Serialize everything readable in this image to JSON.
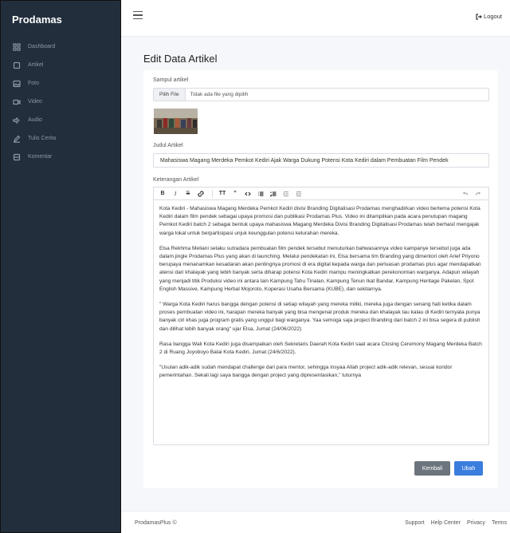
{
  "sidebar": {
    "brand": "Prodamas",
    "items": [
      {
        "label": "Dashboard",
        "icon": "grid-icon"
      },
      {
        "label": "Artikel",
        "icon": "square-icon"
      },
      {
        "label": "Foto",
        "icon": "image-icon"
      },
      {
        "label": "Video",
        "icon": "video-icon"
      },
      {
        "label": "Audio",
        "icon": "speaker-icon"
      },
      {
        "label": "Tulis Cerita",
        "icon": "pen-icon"
      },
      {
        "label": "Komentar",
        "icon": "table-icon"
      }
    ]
  },
  "topbar": {
    "logout_label": "Logout"
  },
  "page": {
    "title": "Edit Data Artikel"
  },
  "form": {
    "cover_label": "Sampul artikel",
    "file_button": "Pilih File",
    "file_status": "Tidak ada file yang dipilih",
    "title_label": "Judul Artikel",
    "title_value": "Mahasiswa Magang Merdeka Pemkot Kediri Ajak Warga Dukung Potensi Kota Kediri dalam Pembuatan Film Pendek",
    "desc_label": "Keterangan Artikel",
    "paragraphs": [
      "Kota Kediri - Mahasiswa Magang Merdeka Pemkot Kediri divisi Branding Digitalisasi Prodamas menghadirkan video bertema potensi Kota Kediri dalam film pendek sebagai upaya promosi dan publikasi Prodamas Plus. Video ini ditampilkan pada acara penutupan magang Pemkot Kediri batch 2 sebagai bentuk upaya mahasiswa Magang Merdeka Divisi Branding Digitalisasi Prodamas telah berhasil mengajak warga lokal untuk berpartisipasi unjuk keunggulan potensi kelurahan mereka.",
      "Elsa Rekhma Meliani selaku sutradara pembuatan film pendek tersebut menuturkan bahwasannya video kampanye tersebut juga ada dalam jingle Prodamas Plus yang akan di launching. Melalui pendekatan ini, Elsa bersama tim Branding yang dimentori oleh Arief Priyono berupaya menanamkan kesadaran akan pentingnya promosi di era digital kepada warga dan perluasan prodamas plus agar mendapatkan atensi dari khalayak yang lebih banyak serta diharap potensi Kota Kediri mampu meningkatkan perekonomian warganya. Adapun wilayah yang menjadi titik Produksi video ini antara lain Kampung Tahu Tinalan, Kampung Tenun Ikat Bandar, Kampung Heritage Pakelan, Spot English Massive, Kampung Herbal Mojoroto, Koperasi Usaha Bersama (KUBE), dan sekitarnya.",
      "\" Warga Kota Kediri harus bangga dengan potensi di setiap wilayah yang mereka miliki, mereka juga dengan senang hati ketika dalam proses pembuatan video ini, harapan mereka banyak yang bisa mengenal produk mereka dan khalayak tau kalau di Kediri ternyata punya banyak ciri khas juga program gratis yang unggul bagi warganya. Yaa semoga saja project Branding dari batch 2 ini bisa segera di publish dan dilihat lebih banyak orang\" ujar Elsa, Jumat (24/06/2022)",
      "Rasa bangga Wali Kota Kediri juga disampaikan oleh Sekretaris Daerah Kota Kediri saat acara Closing Ceremony Magang Merdeka Batch 2 di Ruang Joyoboyo Balai Kota Kediri, Jumat (24/6/2022).",
      "\"Usulan adik-adik sudah mendapat challenge dari para mentor, sehingga insyaa Allah project adik-adik relevan, sesuai koridor pemerintahan. Sekali lagi saya bangga dengan project yang dipresentasikan,\" tuturnya"
    ],
    "back_label": "Kembali",
    "save_label": "Ubah"
  },
  "footer": {
    "copyright": "ProdamasPlus ©",
    "links": [
      "Support",
      "Help Center",
      "Privacy",
      "Terms"
    ]
  },
  "colors": {
    "sidebar": "#222e3c",
    "primary": "#3b7ddd",
    "secondary": "#6c757d"
  }
}
